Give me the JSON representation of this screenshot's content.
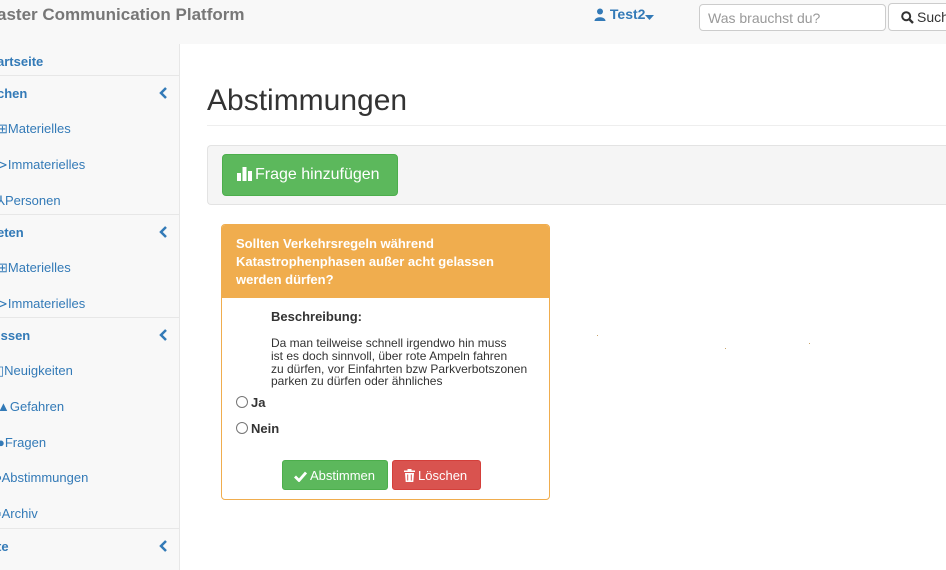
{
  "navbar": {
    "brand": "aster Communication Platform",
    "user": "Test2",
    "search_placeholder": "Was brauchst du?",
    "search_button": "Such"
  },
  "sidebar": {
    "items": [
      {
        "label": "artseite",
        "icon": "home-icon"
      },
      {
        "label": "chen",
        "icon": "chevron-left-icon"
      },
      {
        "label": "Materielles",
        "icon": "box-icon"
      },
      {
        "label": "Immaterielles",
        "icon": "arrow-icon"
      },
      {
        "label": "Personen",
        "icon": "user-icon"
      },
      {
        "label": "eten",
        "icon": "chevron-left-icon"
      },
      {
        "label": "Materielles",
        "icon": "box-icon"
      },
      {
        "label": "Immaterielles",
        "icon": "arrow-icon"
      },
      {
        "label": "issen",
        "icon": "chevron-left-icon"
      },
      {
        "label": "Neuigkeiten",
        "icon": "news-icon"
      },
      {
        "label": "Gefahren",
        "icon": "warning-icon"
      },
      {
        "label": "Fragen",
        "icon": "question-icon"
      },
      {
        "label": "Abstimmungen",
        "icon": "vote-icon"
      },
      {
        "label": "Archiv",
        "icon": "archive-icon"
      },
      {
        "label": "te",
        "icon": "chevron-left-icon"
      }
    ]
  },
  "main": {
    "title": "Abstimmungen",
    "add_button": "Frage hinzufügen",
    "poll": {
      "question_lines": [
        "Sollten Verkehrsregeln während",
        "Katastrophenphasen außer acht gelassen",
        "werden dürfen?"
      ],
      "description_title": "Beschreibung:",
      "description_lines": [
        "Da man teilweise schnell irgendwo hin muss",
        "ist es doch sinnvoll, über rote Ampeln fahren",
        "zu dürfen, vor Einfahrten bzw Parkverbotszonen",
        "parken zu dürfen oder ähnliches"
      ],
      "options": [
        "Ja",
        "Nein"
      ],
      "vote_button": "Abstimmen",
      "delete_button": "Löschen"
    }
  },
  "colors": {
    "link": "#337ab7",
    "success": "#5cb85c",
    "warning": "#f0ad4e",
    "danger": "#d9534f"
  }
}
